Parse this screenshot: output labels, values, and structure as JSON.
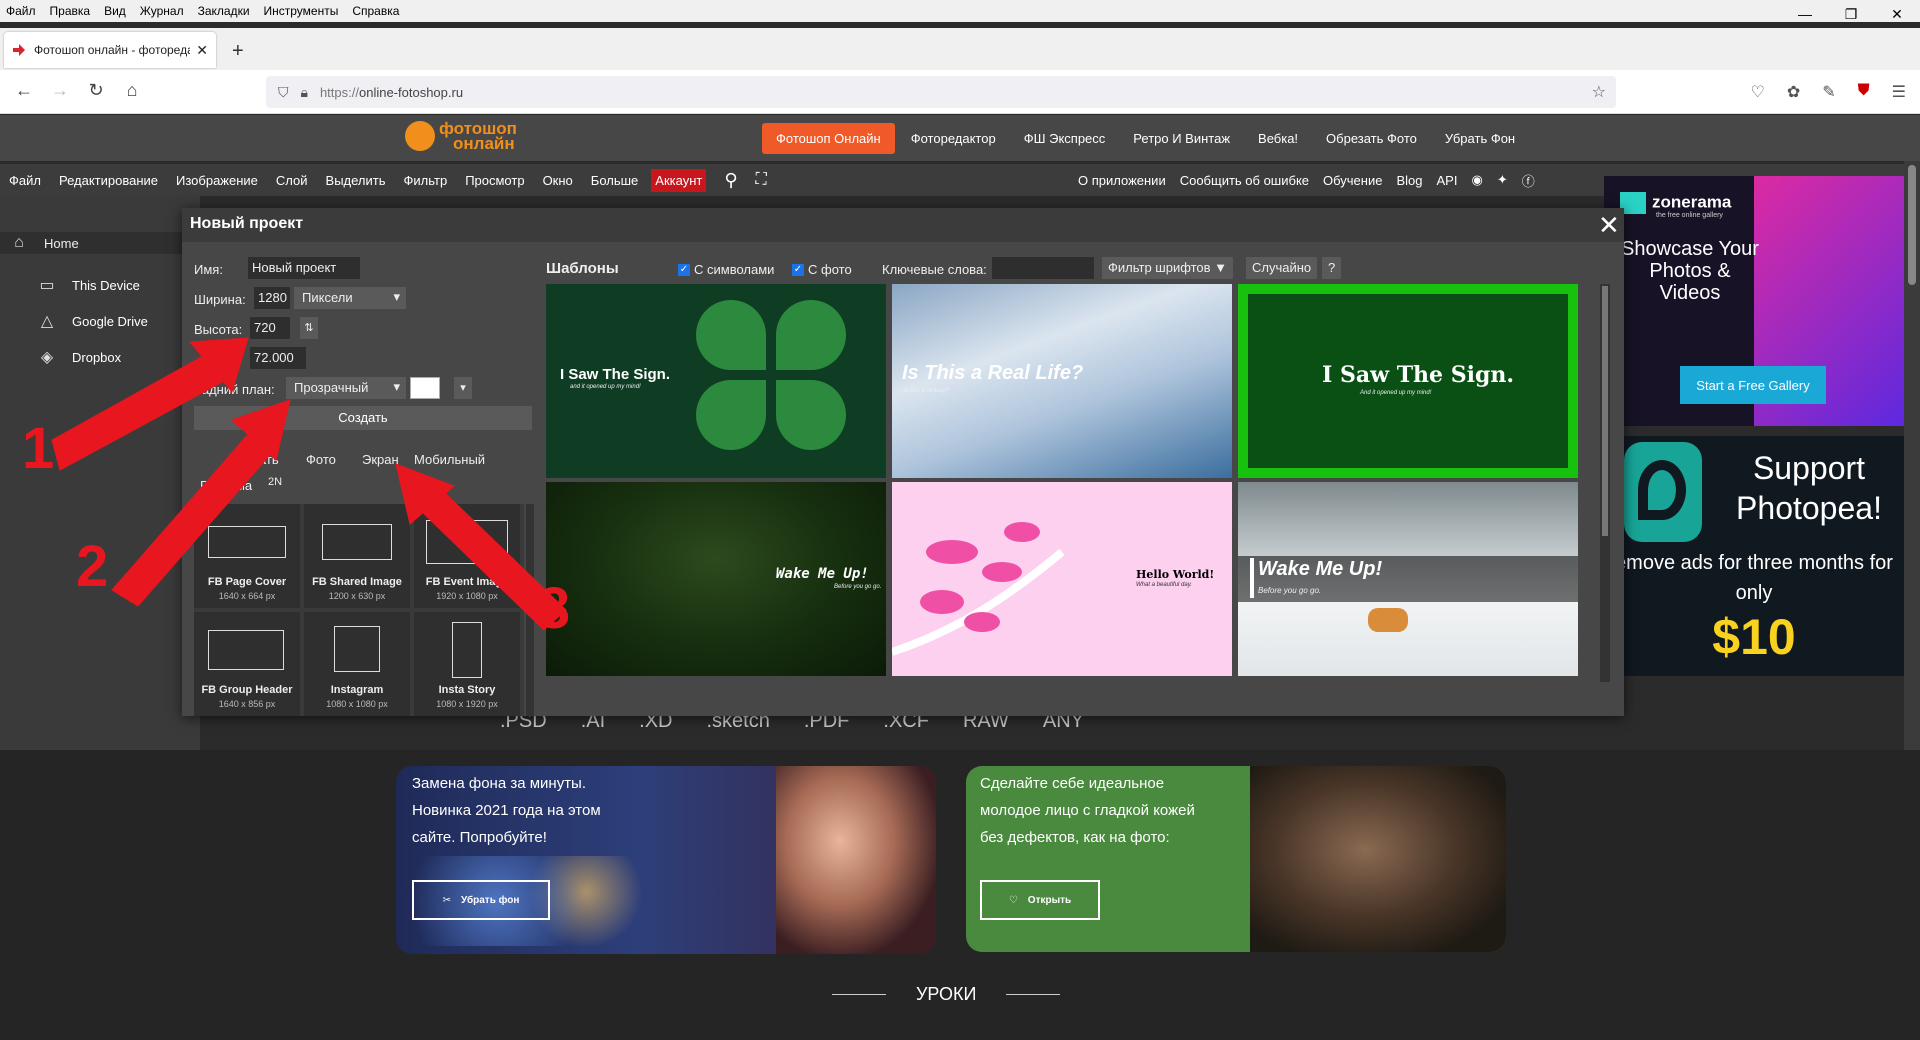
{
  "browser": {
    "menu": [
      "Файл",
      "Правка",
      "Вид",
      "Журнал",
      "Закладки",
      "Инструменты",
      "Справка"
    ],
    "tab_title": "Фотошоп онлайн - фоторедак",
    "url_scheme": "https://",
    "url_host": "online-fotoshop.ru"
  },
  "site": {
    "logo_line1": "фотошоп",
    "logo_line2": "онлайн",
    "nav": [
      "Фотошоп Онлайн",
      "Фоторедактор",
      "ФШ Экспресс",
      "Ретро И Винтаж",
      "Вебка!",
      "Обрезать Фото",
      "Убрать Фон"
    ],
    "accent": "#f05a28"
  },
  "appmenu": {
    "left": [
      "Файл",
      "Редактирование",
      "Изображение",
      "Слой",
      "Выделить",
      "Фильтр",
      "Просмотр",
      "Окно",
      "Больше"
    ],
    "account": "Аккаунт",
    "right": [
      "О приложении",
      "Сообщить об ошибке",
      "Обучение",
      "Blog",
      "API"
    ]
  },
  "sidebar": [
    {
      "label": "Home",
      "icon": "home-icon"
    },
    {
      "label": "This Device",
      "icon": "monitor-icon"
    },
    {
      "label": "Google Drive",
      "icon": "google-drive-icon"
    },
    {
      "label": "Dropbox",
      "icon": "dropbox-icon"
    }
  ],
  "formats": [
    ".PSD",
    ".AI",
    ".XD",
    ".sketch",
    ".PDF",
    ".XCF",
    "RAW",
    "ANY"
  ],
  "dialog": {
    "title": "Новый проект",
    "name_label": "Имя:",
    "name_value": "Новый проект",
    "width_label": "Ширина:",
    "width_value": "1280",
    "unit": "Пиксели",
    "height_label": "Высота:",
    "height_value": "720",
    "dpi_value": "72.000",
    "bg_label": "Задний план:",
    "bg_value": "Прозрачный",
    "create": "Создать",
    "categories": [
      "Печать",
      "Фото",
      "Экран",
      "Мобильный",
      "Реклама",
      "2N"
    ],
    "presets": [
      {
        "name": "FB Page Cover",
        "size": "1640 x 664 px"
      },
      {
        "name": "FB Shared Image",
        "size": "1200 x 630 px"
      },
      {
        "name": "FB Event Image",
        "size": "1920 x 1080 px"
      },
      {
        "name": "FB Group Header",
        "size": "1640 x 856 px"
      },
      {
        "name": "Instagram",
        "size": "1080 x 1080 px"
      },
      {
        "name": "Insta Story",
        "size": "1080 x 1920 px"
      }
    ],
    "templates_title": "Шаблоны",
    "chk_symbols": "С символами",
    "chk_photo": "С фото",
    "keywords_label": "Ключевые слова:",
    "font_filter": "Фильтр шрифтов ▼",
    "random": "Случайно",
    "help": "?",
    "templates": [
      {
        "title": "I Saw The Sign.",
        "sub": "and it opened up my mind!"
      },
      {
        "title": "Is This a Real Life?",
        "sub": "Is this a fantasy?"
      },
      {
        "title": "I Saw The Sign.",
        "sub": "And it opened up my mind!"
      },
      {
        "title": "Wake Me Up!",
        "sub": "Before you go go."
      },
      {
        "title": "Hello World!",
        "sub": "What a beautiful day."
      },
      {
        "title": "Wake Me Up!",
        "sub": "Before you go go."
      }
    ]
  },
  "ads": {
    "zonerama": "zonerama",
    "zonerama_sub": "the free online gallery",
    "showcase": "Showcase Your Photos & Videos",
    "cta": "Start a Free Gallery",
    "support": "Support Photopea!",
    "remove": "emove ads for three months for only",
    "price": "$10"
  },
  "promos": {
    "p1_text": "Замена фона за минуты. Новинка 2021 года на этом сайте. Попробуйте!",
    "p1_btn": "Убрать фон",
    "p2_text": "Сделайте себе идеальное молодое лицо с гладкой кожей без дефектов, как на фото:",
    "p2_btn": "Открыть",
    "lessons": "УРОКИ"
  },
  "annotations": [
    "1",
    "2",
    "3"
  ]
}
